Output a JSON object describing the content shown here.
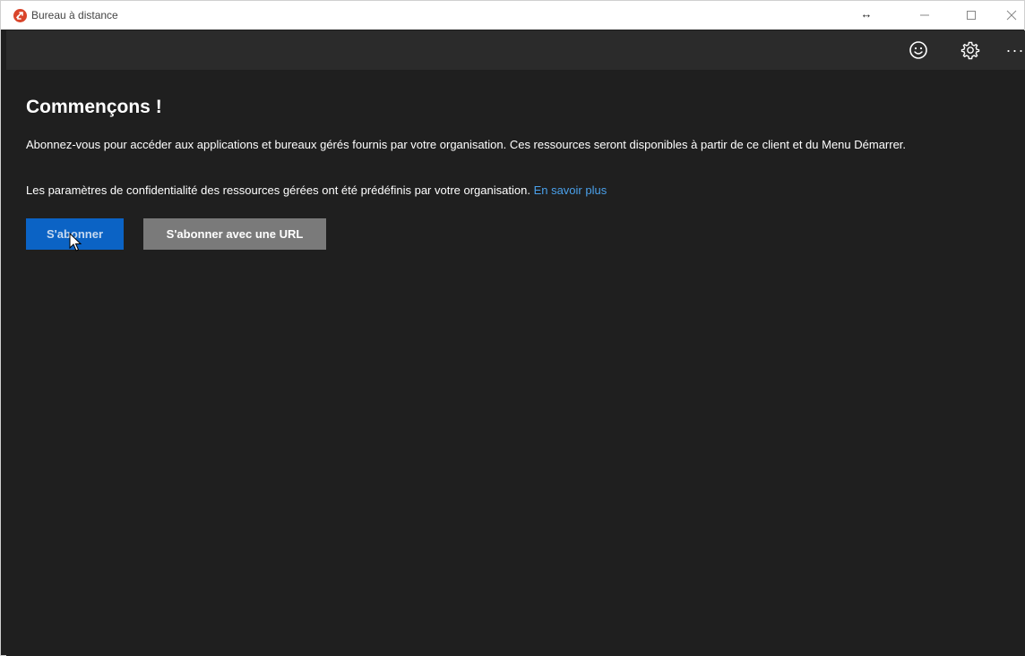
{
  "window": {
    "title": "Bureau à distance",
    "resize_glyph": "↔"
  },
  "toolbar": {
    "icons": [
      "smiley-icon",
      "gear-icon",
      "more-icon"
    ],
    "more_label": "···"
  },
  "main": {
    "heading": "Commençons !",
    "paragraph1": "Abonnez-vous pour accéder aux applications et bureaux gérés fournis par votre organisation. Ces ressources seront disponibles à partir de ce client et du Menu Démarrer.",
    "paragraph2": "Les paramètres de confidentialité des ressources gérées ont été prédéfinis par votre organisation.",
    "learn_more_link": "En savoir plus",
    "subscribe_button": "S'abonner",
    "subscribe_url_button": "S'abonner avec une URL"
  },
  "colors": {
    "background": "#1f1f1f",
    "toolbar": "#2b2b2b",
    "primary_button": "#0b63c5",
    "secondary_button": "#7a7a7a",
    "link": "#4aa0ea",
    "app_icon": "#d9452b"
  }
}
